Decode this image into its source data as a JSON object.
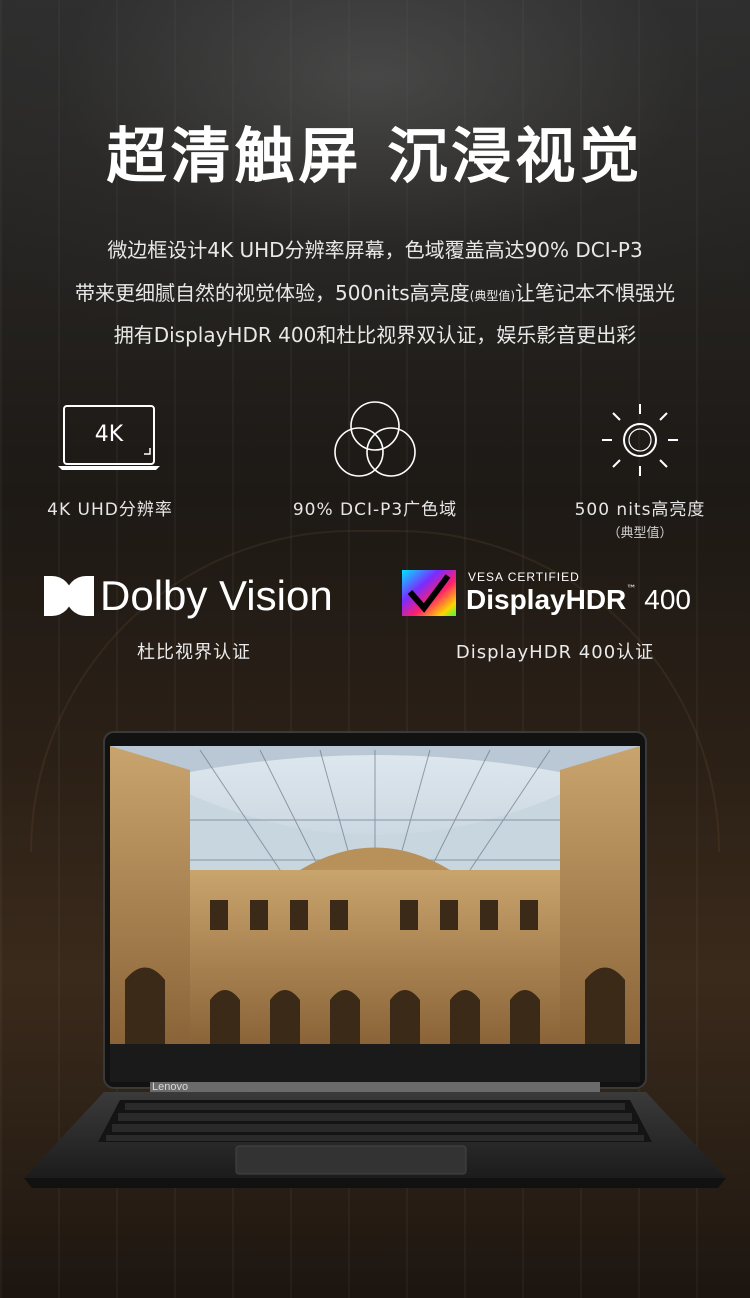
{
  "headline": "超清触屏 沉浸视觉",
  "description": {
    "line1": "微边框设计4K UHD分辨率屏幕，色域覆盖高达90% DCI-P3",
    "line2_a": "带来更细腻自然的视觉体验，500nits高亮度",
    "line2_small": "(典型值)",
    "line2_b": "让笔记本不惧强光",
    "line3": "拥有DisplayHDR 400和杜比视界双认证，娱乐影音更出彩"
  },
  "features": [
    {
      "icon": "laptop-4k-icon",
      "icon_text": "4K",
      "label": "4K UHD分辨率"
    },
    {
      "icon": "color-gamut-circles-icon",
      "label": "90% DCI-P3广色域"
    },
    {
      "icon": "brightness-sun-icon",
      "label": "500 nits高亮度",
      "sub": "（典型值）"
    }
  ],
  "certifications": {
    "dolby": {
      "logo_text": "Dolby Vision",
      "label": "杜比视界认证"
    },
    "vesa": {
      "top_text": "VESA CERTIFIED",
      "brand_text": "DisplayHDR",
      "tm": "™",
      "number": "400",
      "label": "DisplayHDR 400认证"
    }
  },
  "laptop": {
    "brand": "Lenovo"
  },
  "colors": {
    "background": "#1a1410",
    "text": "#ffffff",
    "laptop_body": "#2c2c2c"
  }
}
